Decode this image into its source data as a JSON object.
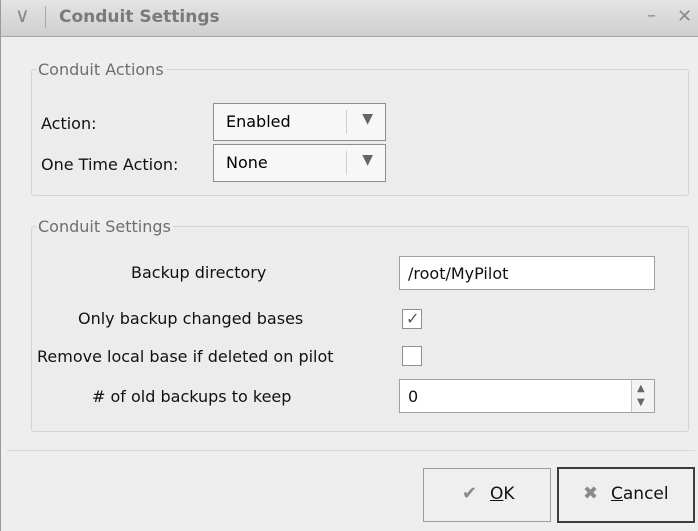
{
  "window": {
    "title": "Conduit Settings",
    "menu_icon": "chevron-down-icon",
    "minimize_icon": "minimize-icon",
    "close_icon": "close-icon"
  },
  "conduit_actions": {
    "legend": "Conduit Actions",
    "action": {
      "label": "Action:",
      "value": "Enabled"
    },
    "one_time_action": {
      "label": "One Time Action:",
      "value": "None"
    }
  },
  "conduit_settings": {
    "legend": "Conduit Settings",
    "backup_directory": {
      "label": "Backup directory",
      "value": "/root/MyPilot"
    },
    "only_backup_changed": {
      "label": "Only backup changed bases",
      "checked": true
    },
    "remove_local_base": {
      "label": "Remove local base if deleted on pilot",
      "checked": false
    },
    "old_backups": {
      "label": "# of old backups to keep",
      "value": "0"
    }
  },
  "buttons": {
    "ok": {
      "label": "OK",
      "mnemonic": "O",
      "rest": "K",
      "icon": "checkmark-icon"
    },
    "cancel": {
      "label": "Cancel",
      "mnemonic": "C",
      "rest": "ancel",
      "icon": "cancel-icon"
    }
  }
}
